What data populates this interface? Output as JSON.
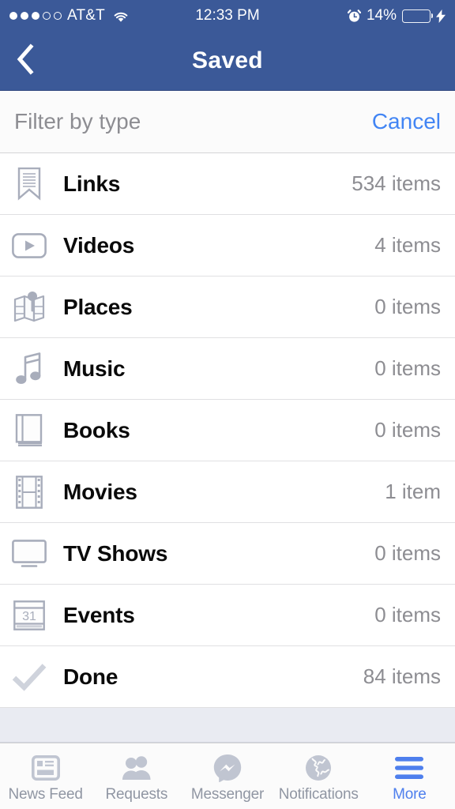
{
  "status_bar": {
    "carrier": "AT&T",
    "signal_dots_filled": 3,
    "signal_dots_total": 5,
    "wifi_icon": "wifi-icon",
    "time": "12:33 PM",
    "alarm_icon": "alarm-clock-icon",
    "battery_percent": "14%",
    "battery_level": 14,
    "battery_color": "#f5392b",
    "charging_icon": "lightning-bolt-icon"
  },
  "navbar": {
    "back_icon": "chevron-left-icon",
    "title": "Saved",
    "background": "#3b5998"
  },
  "filter_bar": {
    "label": "Filter by type",
    "cancel_label": "Cancel",
    "cancel_color": "#4285f4"
  },
  "list": {
    "rows": [
      {
        "icon": "bookmark-icon",
        "label": "Links",
        "count": "534 items"
      },
      {
        "icon": "video-play-icon",
        "label": "Videos",
        "count": "4 items"
      },
      {
        "icon": "map-pin-icon",
        "label": "Places",
        "count": "0 items"
      },
      {
        "icon": "music-note-icon",
        "label": "Music",
        "count": "0 items"
      },
      {
        "icon": "book-icon",
        "label": "Books",
        "count": "0 items"
      },
      {
        "icon": "film-strip-icon",
        "label": "Movies",
        "count": "1 item"
      },
      {
        "icon": "tv-monitor-icon",
        "label": "TV Shows",
        "count": "0 items"
      },
      {
        "icon": "calendar-icon",
        "label": "Events",
        "count": "0 items",
        "calendar_day": "31"
      },
      {
        "icon": "checkmark-icon",
        "label": "Done",
        "count": "84 items"
      }
    ]
  },
  "tabbar": {
    "active_index": 4,
    "active_color": "#4e7fed",
    "inactive_color": "#9096a3",
    "tabs": [
      {
        "icon": "newspaper-icon",
        "label": "News Feed"
      },
      {
        "icon": "friends-icon",
        "label": "Requests"
      },
      {
        "icon": "messenger-icon",
        "label": "Messenger"
      },
      {
        "icon": "globe-icon",
        "label": "Notifications"
      },
      {
        "icon": "hamburger-icon",
        "label": "More"
      }
    ]
  }
}
